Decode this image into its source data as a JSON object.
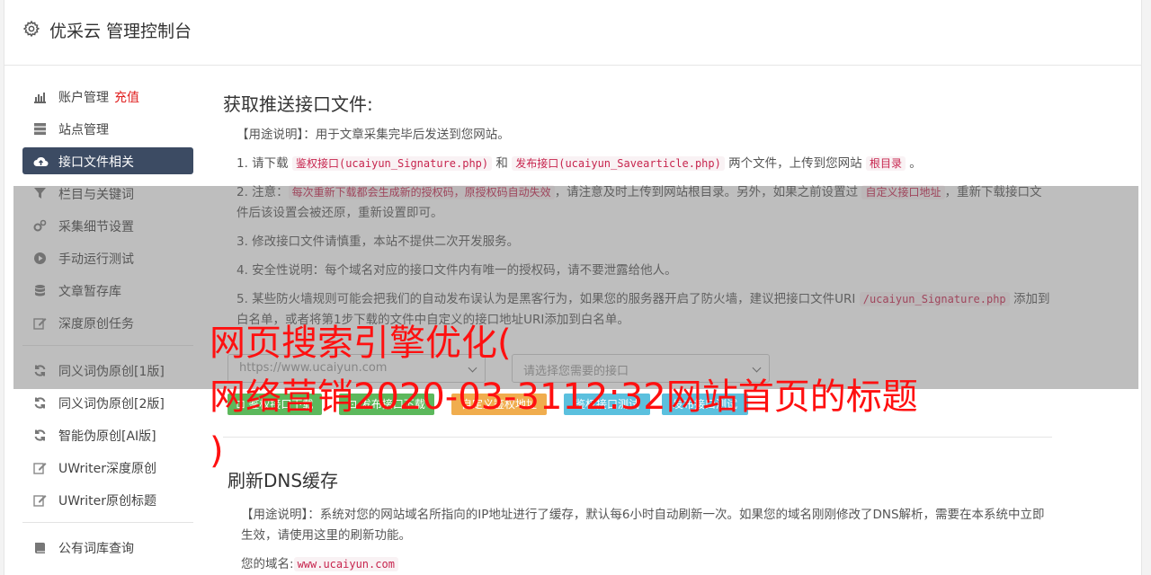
{
  "header": {
    "title": "优采云 管理控制台",
    "icon": "gear-icon"
  },
  "sidebar": {
    "items": [
      {
        "label": "账户管理",
        "badge": "充值",
        "icon": "bar-chart-icon"
      },
      {
        "label": "站点管理",
        "icon": "server-icon"
      },
      {
        "label": "接口文件相关",
        "icon": "cloud-upload-icon",
        "active": true
      },
      {
        "label": "栏目与关键词",
        "icon": "filter-icon"
      },
      {
        "label": "采集细节设置",
        "icon": "cogs-icon"
      },
      {
        "label": "手动运行测试",
        "icon": "play-circle-icon"
      },
      {
        "label": "文章暂存库",
        "icon": "database-icon"
      },
      {
        "label": "深度原创任务",
        "icon": "edit-icon"
      },
      {
        "label": "同义词伪原创[1版]",
        "icon": "refresh-icon"
      },
      {
        "label": "同义词伪原创[2版]",
        "icon": "refresh-icon"
      },
      {
        "label": "智能伪原创[AI版]",
        "icon": "refresh-icon"
      },
      {
        "label": "UWriter深度原创",
        "icon": "edit-icon"
      },
      {
        "label": "UWriter原创标题",
        "icon": "edit-icon"
      },
      {
        "label": "公有词库查询",
        "icon": "book-icon"
      }
    ]
  },
  "section1": {
    "title": "获取推送接口文件:",
    "usage_label": "【用途说明】",
    "usage_text": "：用于文章采集完毕后发送到您网站。",
    "item1": {
      "a": "1. 请下载 ",
      "code1": "鉴权接口(ucaiyun_Signature.php)",
      "b": " 和 ",
      "code2": "发布接口(ucaiyun_Savearticle.php)",
      "c": " 两个文件，上传到您网站 ",
      "code3": "根目录",
      "d": " 。"
    },
    "item2": {
      "a": "2. 注意：",
      "code1": "每次重新下载都会生成新的授权码，原授权码自动失效",
      "b": "，请注意及时上传到网站根目录。另外，如果之前设置过 ",
      "code2": "自定义接口地址",
      "c": "，重新下载接口文件后该设置会被还原，重新设置即可。"
    },
    "item3": "3. 修改接口文件请慎重，本站不提供二次开发服务。",
    "item4": "4. 安全性说明：每个域名对应的接口文件内有唯一的授权码，请不要泄露给他人。",
    "item5": {
      "a": "5. 某些防火墙规则可能会把我们的自动发布误认为是黑客行为，如果您的服务器开启了防火墙，建议把接口文件URI ",
      "code1": "/ucaiyun_Signature.php",
      "b": " 添加到白名单，或者将第1步下载的文件中自定义的接口地址URI添加到白名单。"
    },
    "select_site": "https://www.ucaiyun.com",
    "select_api": "请选择您需要的接口",
    "buttons": {
      "download_sign": "鉴权接口下载",
      "download_publish": "发布接口下载",
      "custom_sign_addr": "自定义鉴权地址",
      "test_sign": "鉴权接口测试",
      "test_publish": "发布接口测试"
    }
  },
  "section2": {
    "title": "刷新DNS缓存",
    "usage_label": "【用途说明】",
    "usage_text": "：系统对您的网站域名所指向的IP地址进行了缓存，默认每6小时自动刷新一次。如果您的域名刚刚修改了DNS解析，需要在本系统中立即生效，请使用这里的刷新功能。",
    "domain_label": "您的域名:",
    "domain_value": "www.ucaiyun.com"
  },
  "watermark": {
    "line1": "网页搜索引擎优化(",
    "line2": "网络营销2020-03-3112:32网站首页的标题",
    "line3": ")"
  },
  "colors": {
    "sidebar_active": "#3c4b63",
    "badge": "#e02020",
    "btn_green": "#5cb85c",
    "btn_orange": "#f0ad4e",
    "btn_blue": "#5bc0de",
    "watermark": "#ff1010"
  }
}
